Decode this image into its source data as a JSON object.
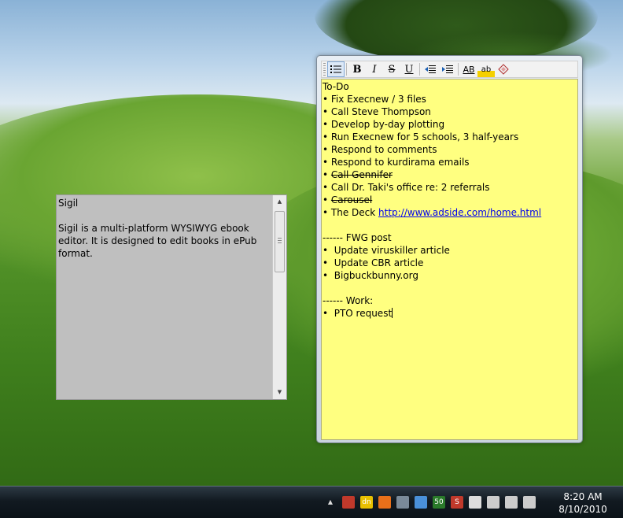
{
  "gray_note": {
    "title": "Sigil",
    "body": "Sigil is a multi-platform WYSIWYG ebook editor. It is designed to edit books in ePub format."
  },
  "toolbar": {
    "buttons": [
      {
        "label": "",
        "icon": "bullet-list-icon"
      },
      {
        "label": "B",
        "icon": "bold-icon"
      },
      {
        "label": "I",
        "icon": "italic-icon"
      },
      {
        "label": "S",
        "icon": "strikethrough-icon"
      },
      {
        "label": "U",
        "icon": "underline-icon"
      },
      {
        "label": "",
        "icon": "decrease-indent-icon"
      },
      {
        "label": "",
        "icon": "increase-indent-icon"
      },
      {
        "label": "AB",
        "icon": "font-icon"
      },
      {
        "label": "ab",
        "icon": "highlight-icon"
      },
      {
        "label": "",
        "icon": "clear-format-icon"
      }
    ]
  },
  "sticky_note": {
    "lines": [
      {
        "text": "To-Do"
      },
      {
        "text": "• Fix Execnew / 3 files"
      },
      {
        "text": "• Call Steve Thompson"
      },
      {
        "text": "• Develop by-day plotting"
      },
      {
        "text": "• Run Execnew for 5 schools, 3 half-years"
      },
      {
        "text": "• Respond to comments"
      },
      {
        "text": "• Respond to kurdirama emails"
      },
      {
        "bullet": "• ",
        "struck": "Call Gennifer"
      },
      {
        "text": "• Call Dr. Taki's office re: 2 referrals"
      },
      {
        "bullet": "• ",
        "struck": "Carousel"
      },
      {
        "text": "• The Deck ",
        "link": "http://www.adside.com/home.html"
      },
      {
        "text": ""
      },
      {
        "text": "------ FWG post"
      },
      {
        "text": "•  Update viruskiller article"
      },
      {
        "text": "•  Update CBR article"
      },
      {
        "text": "•  Bigbuckbunny.org"
      },
      {
        "text": ""
      },
      {
        "text": "------ Work:"
      },
      {
        "text": "•  PTO request",
        "caret": true
      }
    ]
  },
  "taskbar": {
    "tray_icons": [
      {
        "icon": "show-hidden-icons-icon",
        "label": "▲",
        "color": "#dddddd"
      },
      {
        "icon": "app-tray-icon",
        "label": "",
        "color": "#c0392b"
      },
      {
        "icon": "dn-icon",
        "label": "dn",
        "color": "#e8c000"
      },
      {
        "icon": "flame-icon",
        "label": "",
        "color": "#e8701a"
      },
      {
        "icon": "usb-device-icon",
        "label": "",
        "color": "#7a8a99"
      },
      {
        "icon": "monitor-icon",
        "label": "",
        "color": "#4a90d9"
      },
      {
        "icon": "counter-icon",
        "label": "50",
        "color": "#2a7a2a"
      },
      {
        "icon": "s-icon",
        "label": "S",
        "color": "#c0392b"
      },
      {
        "icon": "action-center-flag-icon",
        "label": "",
        "color": "#dddddd"
      },
      {
        "icon": "battery-icon",
        "label": "",
        "color": "#cccccc"
      },
      {
        "icon": "network-icon",
        "label": "",
        "color": "#cccccc"
      },
      {
        "icon": "volume-icon",
        "label": "",
        "color": "#cccccc"
      }
    ],
    "time": "8:20 AM",
    "date": "8/10/2010"
  }
}
